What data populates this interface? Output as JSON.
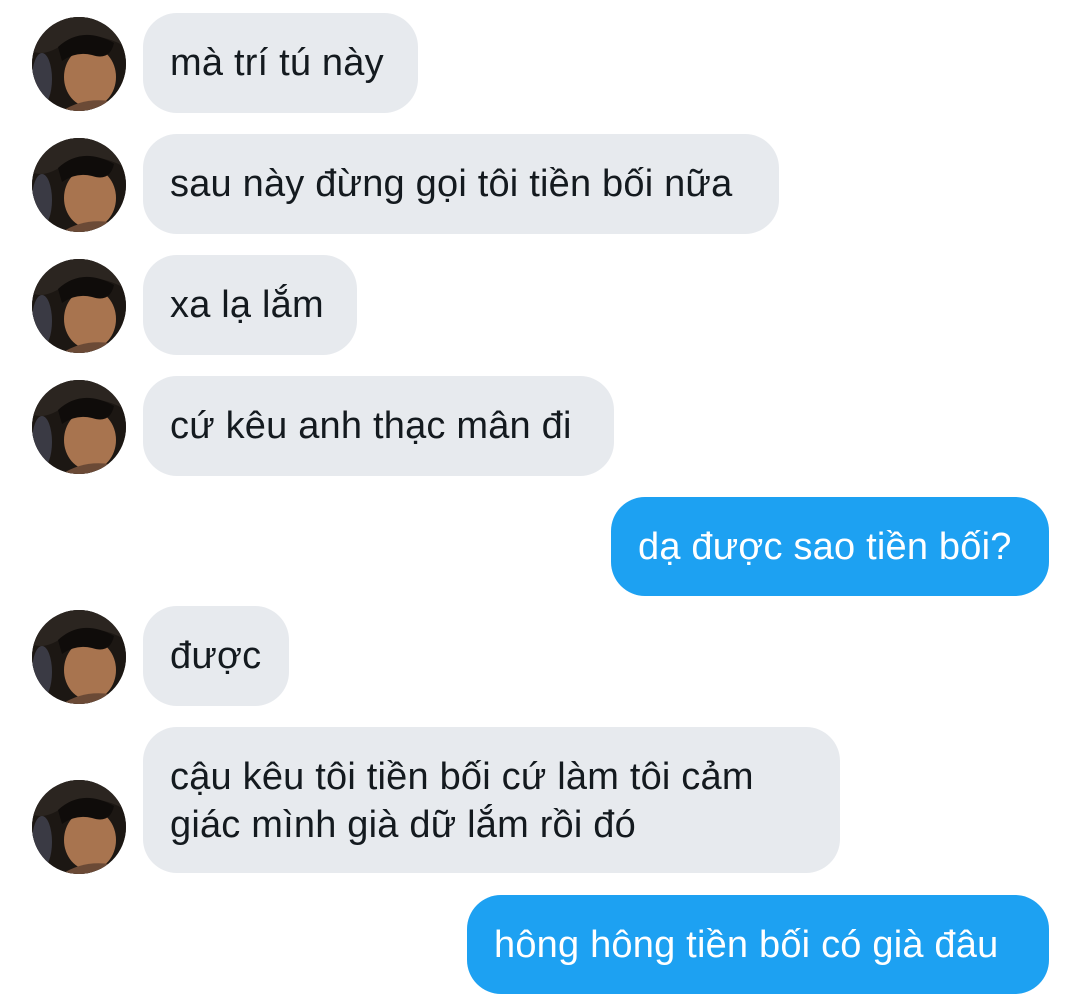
{
  "conversation": {
    "messages": [
      {
        "sender": "other",
        "text": "mà trí tú này"
      },
      {
        "sender": "other",
        "text": "sau này đừng gọi tôi tiền bối nữa"
      },
      {
        "sender": "other",
        "text": "xa lạ lắm"
      },
      {
        "sender": "other",
        "text": "cứ kêu anh thạc mân đi"
      },
      {
        "sender": "me",
        "text": "dạ được sao tiền bối?"
      },
      {
        "sender": "other",
        "text": "được"
      },
      {
        "sender": "other",
        "text": "cậu kêu tôi tiền bối cứ làm tôi cảm giác mình già dữ lắm rồi đó"
      },
      {
        "sender": "me",
        "text": "hông hông tiền bối có già đâu"
      }
    ]
  },
  "colors": {
    "incoming_bubble": "#e7eaee",
    "outgoing_bubble": "#1da1f2",
    "incoming_text": "#141a1f",
    "outgoing_text": "#ffffff"
  },
  "icons": {
    "avatar": "profile-photo"
  }
}
